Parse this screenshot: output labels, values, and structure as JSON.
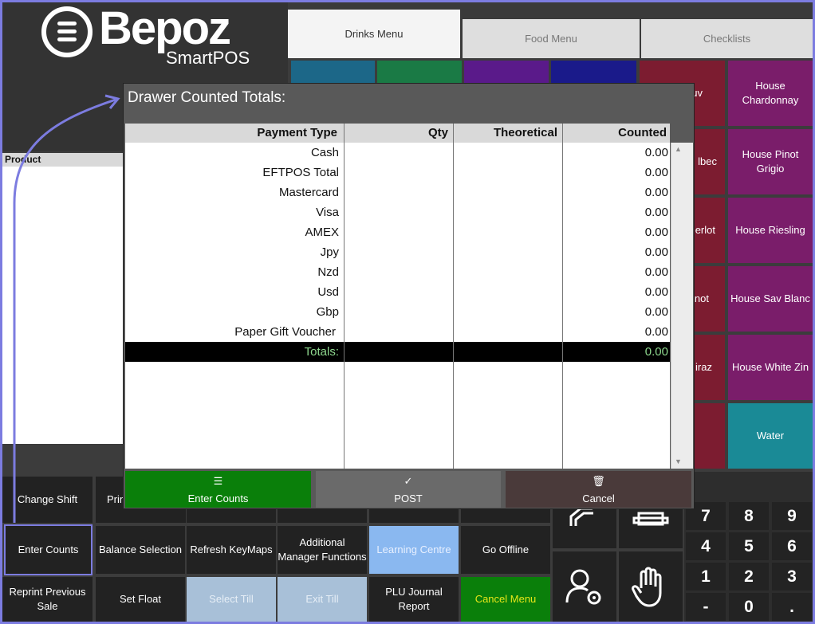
{
  "logo": {
    "brand": "Bepoz",
    "sub": "SmartPOS"
  },
  "tabs": [
    "Drinks Menu",
    "Food Menu",
    "Checklists"
  ],
  "product_header": "Product",
  "tiles": [
    {
      "label": "House Chardonnay",
      "color": "#7a1d6a"
    },
    {
      "label": "House Pinot Grigio",
      "color": "#7a1d6a"
    },
    {
      "label": "House Riesling",
      "color": "#7a1d6a"
    },
    {
      "label": "House Sav Blanc",
      "color": "#7a1d6a"
    },
    {
      "label": "House White Zin",
      "color": "#7a1d6a"
    },
    {
      "label": "Water",
      "color": "#1a8a96"
    }
  ],
  "partial_tiles": [
    "uv",
    "lbec",
    "erlot",
    "not",
    "iraz"
  ],
  "dialog": {
    "title": "Drawer Counted Totals:",
    "columns": [
      "Payment Type",
      "Qty",
      "Theoretical",
      "Counted"
    ],
    "rows": [
      {
        "type": "Cash",
        "counted": "0.00"
      },
      {
        "type": "EFTPOS Total",
        "counted": "0.00"
      },
      {
        "type": "Mastercard",
        "counted": "0.00"
      },
      {
        "type": "Visa",
        "counted": "0.00"
      },
      {
        "type": "AMEX",
        "counted": "0.00"
      },
      {
        "type": "Jpy",
        "counted": "0.00"
      },
      {
        "type": "Nzd",
        "counted": "0.00"
      },
      {
        "type": "Usd",
        "counted": "0.00"
      },
      {
        "type": "Gbp",
        "counted": "0.00"
      },
      {
        "type": "Paper Gift Voucher",
        "counted": "0.00"
      }
    ],
    "totals": {
      "label": "Totals:",
      "counted": "0.00"
    },
    "buttons": {
      "enter_counts": "Enter Counts",
      "post": "POST",
      "cancel": "Cancel"
    }
  },
  "function_buttons": {
    "change_shift": "Change Shift",
    "print_partial": "Prin",
    "enter_counts": "Enter Counts",
    "balance_selection": "Balance Selection",
    "refresh_keymaps": "Refresh KeyMaps",
    "additional_manager": "Additional Manager Functions",
    "learning_centre": "Learning Centre",
    "go_offline": "Go Offline",
    "reprint_previous": "Reprint Previous Sale",
    "set_float": "Set Float",
    "select_till": "Select Till",
    "exit_till": "Exit Till",
    "plu_journal": "PLU Journal Report",
    "cancel_menu": "Cancel Menu"
  },
  "keypad": [
    "7",
    "8",
    "9",
    "4",
    "5",
    "6",
    "1",
    "2",
    "3",
    "-",
    "0",
    "."
  ],
  "colors": {
    "green": "#0a7f0a",
    "callout": "#7c7ce0",
    "totals_text": "#8ed88e"
  }
}
